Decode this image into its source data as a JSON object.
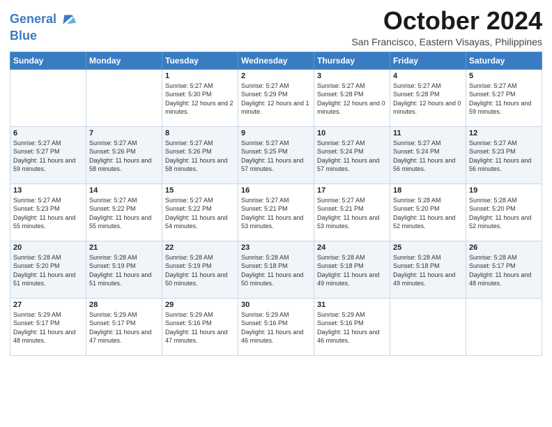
{
  "logo": {
    "line1": "General",
    "line2": "Blue"
  },
  "title": "October 2024",
  "location": "San Francisco, Eastern Visayas, Philippines",
  "days_of_week": [
    "Sunday",
    "Monday",
    "Tuesday",
    "Wednesday",
    "Thursday",
    "Friday",
    "Saturday"
  ],
  "weeks": [
    [
      {
        "num": "",
        "sunrise": "",
        "sunset": "",
        "daylight": ""
      },
      {
        "num": "",
        "sunrise": "",
        "sunset": "",
        "daylight": ""
      },
      {
        "num": "1",
        "sunrise": "Sunrise: 5:27 AM",
        "sunset": "Sunset: 5:30 PM",
        "daylight": "Daylight: 12 hours and 2 minutes."
      },
      {
        "num": "2",
        "sunrise": "Sunrise: 5:27 AM",
        "sunset": "Sunset: 5:29 PM",
        "daylight": "Daylight: 12 hours and 1 minute."
      },
      {
        "num": "3",
        "sunrise": "Sunrise: 5:27 AM",
        "sunset": "Sunset: 5:28 PM",
        "daylight": "Daylight: 12 hours and 0 minutes."
      },
      {
        "num": "4",
        "sunrise": "Sunrise: 5:27 AM",
        "sunset": "Sunset: 5:28 PM",
        "daylight": "Daylight: 12 hours and 0 minutes."
      },
      {
        "num": "5",
        "sunrise": "Sunrise: 5:27 AM",
        "sunset": "Sunset: 5:27 PM",
        "daylight": "Daylight: 11 hours and 59 minutes."
      }
    ],
    [
      {
        "num": "6",
        "sunrise": "Sunrise: 5:27 AM",
        "sunset": "Sunset: 5:27 PM",
        "daylight": "Daylight: 11 hours and 59 minutes."
      },
      {
        "num": "7",
        "sunrise": "Sunrise: 5:27 AM",
        "sunset": "Sunset: 5:26 PM",
        "daylight": "Daylight: 11 hours and 58 minutes."
      },
      {
        "num": "8",
        "sunrise": "Sunrise: 5:27 AM",
        "sunset": "Sunset: 5:26 PM",
        "daylight": "Daylight: 11 hours and 58 minutes."
      },
      {
        "num": "9",
        "sunrise": "Sunrise: 5:27 AM",
        "sunset": "Sunset: 5:25 PM",
        "daylight": "Daylight: 11 hours and 57 minutes."
      },
      {
        "num": "10",
        "sunrise": "Sunrise: 5:27 AM",
        "sunset": "Sunset: 5:24 PM",
        "daylight": "Daylight: 11 hours and 57 minutes."
      },
      {
        "num": "11",
        "sunrise": "Sunrise: 5:27 AM",
        "sunset": "Sunset: 5:24 PM",
        "daylight": "Daylight: 11 hours and 56 minutes."
      },
      {
        "num": "12",
        "sunrise": "Sunrise: 5:27 AM",
        "sunset": "Sunset: 5:23 PM",
        "daylight": "Daylight: 11 hours and 56 minutes."
      }
    ],
    [
      {
        "num": "13",
        "sunrise": "Sunrise: 5:27 AM",
        "sunset": "Sunset: 5:23 PM",
        "daylight": "Daylight: 11 hours and 55 minutes."
      },
      {
        "num": "14",
        "sunrise": "Sunrise: 5:27 AM",
        "sunset": "Sunset: 5:22 PM",
        "daylight": "Daylight: 11 hours and 55 minutes."
      },
      {
        "num": "15",
        "sunrise": "Sunrise: 5:27 AM",
        "sunset": "Sunset: 5:22 PM",
        "daylight": "Daylight: 11 hours and 54 minutes."
      },
      {
        "num": "16",
        "sunrise": "Sunrise: 5:27 AM",
        "sunset": "Sunset: 5:21 PM",
        "daylight": "Daylight: 11 hours and 53 minutes."
      },
      {
        "num": "17",
        "sunrise": "Sunrise: 5:27 AM",
        "sunset": "Sunset: 5:21 PM",
        "daylight": "Daylight: 11 hours and 53 minutes."
      },
      {
        "num": "18",
        "sunrise": "Sunrise: 5:28 AM",
        "sunset": "Sunset: 5:20 PM",
        "daylight": "Daylight: 11 hours and 52 minutes."
      },
      {
        "num": "19",
        "sunrise": "Sunrise: 5:28 AM",
        "sunset": "Sunset: 5:20 PM",
        "daylight": "Daylight: 11 hours and 52 minutes."
      }
    ],
    [
      {
        "num": "20",
        "sunrise": "Sunrise: 5:28 AM",
        "sunset": "Sunset: 5:20 PM",
        "daylight": "Daylight: 11 hours and 51 minutes."
      },
      {
        "num": "21",
        "sunrise": "Sunrise: 5:28 AM",
        "sunset": "Sunset: 5:19 PM",
        "daylight": "Daylight: 11 hours and 51 minutes."
      },
      {
        "num": "22",
        "sunrise": "Sunrise: 5:28 AM",
        "sunset": "Sunset: 5:19 PM",
        "daylight": "Daylight: 11 hours and 50 minutes."
      },
      {
        "num": "23",
        "sunrise": "Sunrise: 5:28 AM",
        "sunset": "Sunset: 5:18 PM",
        "daylight": "Daylight: 11 hours and 50 minutes."
      },
      {
        "num": "24",
        "sunrise": "Sunrise: 5:28 AM",
        "sunset": "Sunset: 5:18 PM",
        "daylight": "Daylight: 11 hours and 49 minutes."
      },
      {
        "num": "25",
        "sunrise": "Sunrise: 5:28 AM",
        "sunset": "Sunset: 5:18 PM",
        "daylight": "Daylight: 11 hours and 49 minutes."
      },
      {
        "num": "26",
        "sunrise": "Sunrise: 5:28 AM",
        "sunset": "Sunset: 5:17 PM",
        "daylight": "Daylight: 11 hours and 48 minutes."
      }
    ],
    [
      {
        "num": "27",
        "sunrise": "Sunrise: 5:29 AM",
        "sunset": "Sunset: 5:17 PM",
        "daylight": "Daylight: 11 hours and 48 minutes."
      },
      {
        "num": "28",
        "sunrise": "Sunrise: 5:29 AM",
        "sunset": "Sunset: 5:17 PM",
        "daylight": "Daylight: 11 hours and 47 minutes."
      },
      {
        "num": "29",
        "sunrise": "Sunrise: 5:29 AM",
        "sunset": "Sunset: 5:16 PM",
        "daylight": "Daylight: 11 hours and 47 minutes."
      },
      {
        "num": "30",
        "sunrise": "Sunrise: 5:29 AM",
        "sunset": "Sunset: 5:16 PM",
        "daylight": "Daylight: 11 hours and 46 minutes."
      },
      {
        "num": "31",
        "sunrise": "Sunrise: 5:29 AM",
        "sunset": "Sunset: 5:16 PM",
        "daylight": "Daylight: 11 hours and 46 minutes."
      },
      {
        "num": "",
        "sunrise": "",
        "sunset": "",
        "daylight": ""
      },
      {
        "num": "",
        "sunrise": "",
        "sunset": "",
        "daylight": ""
      }
    ]
  ]
}
